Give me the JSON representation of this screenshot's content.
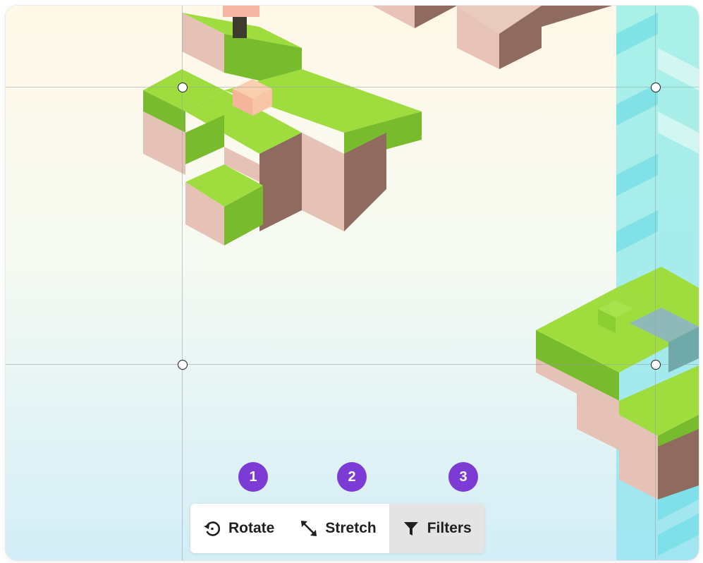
{
  "markers": [
    "1",
    "2",
    "3"
  ],
  "toolbar": {
    "rotate": {
      "label": "Rotate",
      "icon": "rotate-icon"
    },
    "stretch": {
      "label": "Stretch",
      "icon": "stretch-icon"
    },
    "filters": {
      "label": "Filters",
      "icon": "filter-icon",
      "selected": true
    }
  },
  "colors": {
    "accent": "#7d3bd6",
    "grass_top": "#9fdd3e",
    "grass_side": "#78bb2c",
    "dirt_light": "#e6c2b6",
    "dirt_dark": "#8e6a5f",
    "water": "#8fe6ec"
  }
}
